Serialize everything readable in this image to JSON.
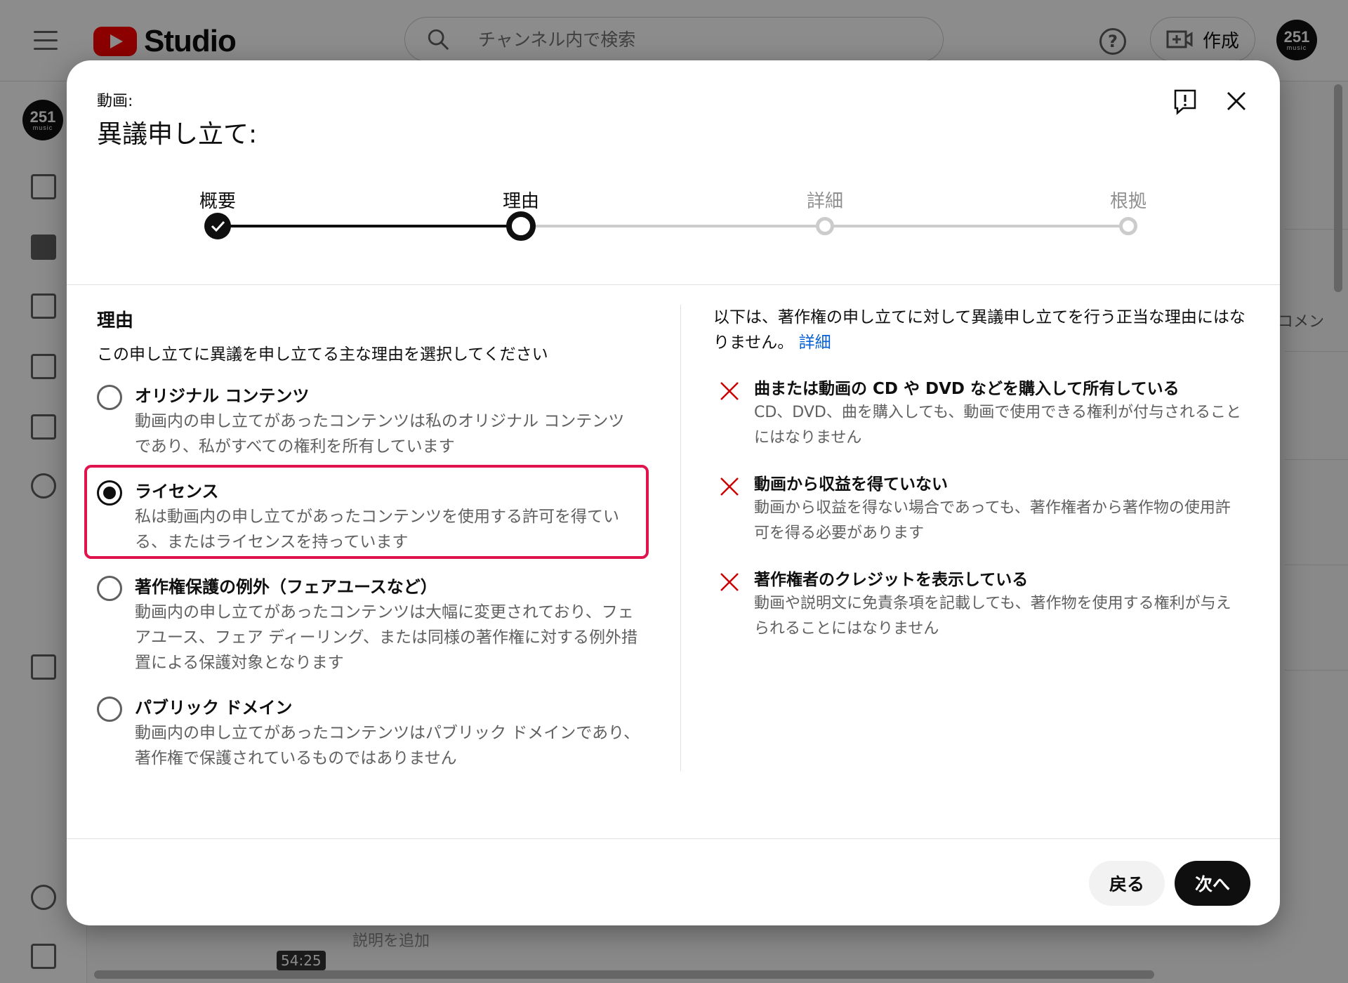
{
  "app": {
    "brand": "Studio",
    "search_placeholder": "チャンネル内で検索",
    "create_label": "作成",
    "help_symbol": "?",
    "avatar_text": "251",
    "avatar_sub": "music",
    "bg_comment": "コメン",
    "bg_description": "説明を追加",
    "bg_duration": "54:25"
  },
  "dialog": {
    "kicker": "動画:",
    "title": "異議申し立て:",
    "steps": [
      {
        "label": "概要",
        "state": "done"
      },
      {
        "label": "理由",
        "state": "current"
      },
      {
        "label": "詳細",
        "state": "pending"
      },
      {
        "label": "根拠",
        "state": "pending"
      }
    ],
    "section_title": "理由",
    "section_subtitle": "この申し立てに異議を申し立てる主な理由を選択してください",
    "options": [
      {
        "title": "オリジナル コンテンツ",
        "desc": "動画内の申し立てがあったコンテンツは私のオリジナル コンテンツであり、私がすべての権利を所有しています",
        "checked": false
      },
      {
        "title": "ライセンス",
        "desc": "私は動画内の申し立てがあったコンテンツを使用する許可を得ている、またはライセンスを持っています",
        "checked": true
      },
      {
        "title": "著作権保護の例外（フェアユースなど）",
        "desc": "動画内の申し立てがあったコンテンツは大幅に変更されており、フェアユース、フェア ディーリング、または同様の著作権に対する例外措置による保護対象となります",
        "checked": false
      },
      {
        "title": "パブリック ドメイン",
        "desc": "動画内の申し立てがあったコンテンツはパブリック ドメインであり、著作権で保護されているものではありません",
        "checked": false
      }
    ],
    "intro": "以下は、著作権の申し立てに対して異議申し立てを行う正当な理由にはなりません。",
    "intro_link": "詳細",
    "invalid_reasons": [
      {
        "title": "曲または動画の CD や DVD などを購入して所有している",
        "desc": "CD、DVD、曲を購入しても、動画で使用できる権利が付与されることにはなりません"
      },
      {
        "title": "動画から収益を得ていない",
        "desc": "動画から収益を得ない場合であっても、著作権者から著作物の使用許可を得る必要があります"
      },
      {
        "title": "著作権者のクレジットを表示している",
        "desc": "動画や説明文に免責条項を記載しても、著作物を使用する権利が与えられることにはなりません"
      }
    ],
    "back_label": "戻る",
    "next_label": "次へ"
  },
  "colors": {
    "highlight": "#e0144c",
    "link": "#065fd4",
    "invalid_x": "#cc0000"
  }
}
